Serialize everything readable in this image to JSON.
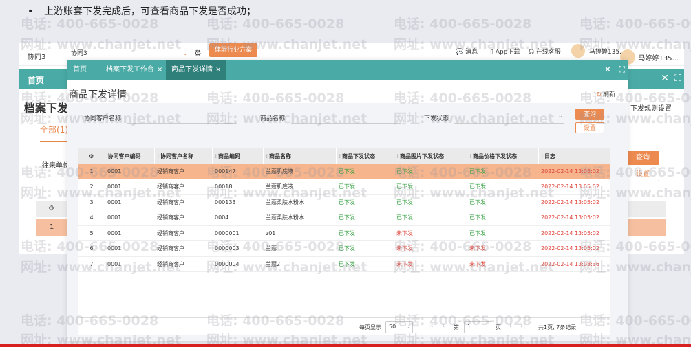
{
  "caption": {
    "bullet": "•",
    "text": "上游账套下发完成后，可查看商品下发是否成功；"
  },
  "watermark": {
    "phone": "电话: 400-665-0028",
    "site": "网址: www.chanjet.net"
  },
  "bg_window": {
    "account": "协同3",
    "account_select": "协同3",
    "industry_button": "体验行业方案",
    "messages": "消息",
    "app_download": "App下载",
    "online_service": "在线客服",
    "user1": "马婷婷135...",
    "user2": "马婷婷135...",
    "home_tab": "首页",
    "page_title": "档案下发",
    "rule_setting": "下发规则设置",
    "tab_all": "全部(1)",
    "filter_label": "往来单位",
    "query_button": "查询",
    "setting_button": "设置",
    "row_index": "1"
  },
  "modal": {
    "tabs": [
      {
        "label": "首页"
      },
      {
        "label": "档案下发工作台",
        "closable": true
      },
      {
        "label": "商品下发详情",
        "closable": true,
        "active": true
      }
    ],
    "title": "商品下发详情",
    "refresh": "刷新",
    "filters": {
      "customer_label": "协同客户名称",
      "product_label": "商品名称",
      "status_label": "下发状态",
      "query_button": "查询",
      "setting_button": "设置"
    },
    "table": {
      "columns": [
        "协同客户编码",
        "协同客户名称",
        "商品编码",
        "商品名称",
        "商品下发状态",
        "商品图片下发状态",
        "商品价格下发状态",
        "日志"
      ],
      "rows": [
        {
          "idx": "1",
          "code": "0001",
          "name": "经销商客户",
          "pcode": "000147",
          "pname": "兰蔻肌底液",
          "s1": "已下发",
          "s2": "已下发",
          "s3": "已下发",
          "log": "2022-02-14 13:05:02"
        },
        {
          "idx": "2",
          "code": "0001",
          "name": "经销商客户",
          "pcode": "00018",
          "pname": "兰蔻肌底液",
          "s1": "已下发",
          "s2": "已下发",
          "s3": "已下发",
          "log": "2022-02-14 13:05:02"
        },
        {
          "idx": "3",
          "code": "0001",
          "name": "经销商客户",
          "pcode": "000133",
          "pname": "兰蔻柔肤水粉水",
          "s1": "已下发",
          "s2": "已下发",
          "s3": "已下发",
          "log": "2022-02-14 13:05:02"
        },
        {
          "idx": "4",
          "code": "0001",
          "name": "经销商客户",
          "pcode": "0004",
          "pname": "兰蔻柔肤水粉水",
          "s1": "已下发",
          "s2": "已下发",
          "s3": "已下发",
          "log": "2022-02-14 13:05:02"
        },
        {
          "idx": "5",
          "code": "0001",
          "name": "经销商客户",
          "pcode": "0000001",
          "pname": "z01",
          "s1": "已下发",
          "s2": "未下发",
          "s3": "已下发",
          "log": "2022-02-14 13:05:02"
        },
        {
          "idx": "6",
          "code": "0001",
          "name": "经销商客户",
          "pcode": "0000003",
          "pname": "兰蔻",
          "s1": "已下发",
          "s2": "未下发",
          "s3": "未下发",
          "log": "2022-02-14 13:05:02"
        },
        {
          "idx": "7",
          "code": "0001",
          "name": "经销商客户",
          "pcode": "0000004",
          "pname": "兰蔻2",
          "s1": "已下发",
          "s2": "未下发",
          "s3": "未下发",
          "log": "2022-02-14 13:08:36"
        }
      ]
    },
    "pager": {
      "per_page_label": "每页显示",
      "per_page": "50",
      "page_prefix": "第",
      "page": "1",
      "page_suffix": "页",
      "summary": "共1页, 7条记录"
    }
  },
  "colors": {
    "teal": "#4aaaa5",
    "orange": "#ec8a4f",
    "ok": "#2f9e3c",
    "no": "#e0453a",
    "highlight": "#f6b58d"
  }
}
